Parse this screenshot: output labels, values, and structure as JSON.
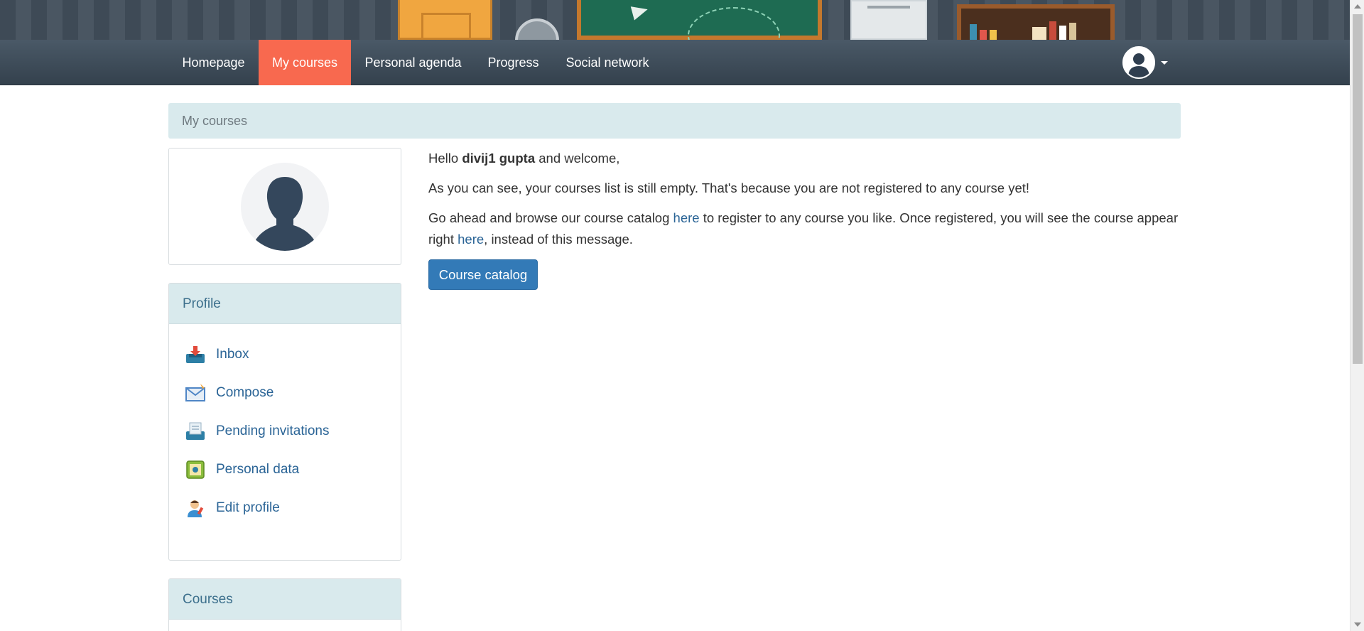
{
  "nav": {
    "items": [
      {
        "label": "Homepage",
        "active": false
      },
      {
        "label": "My courses",
        "active": true
      },
      {
        "label": "Personal agenda",
        "active": false
      },
      {
        "label": "Progress",
        "active": false
      },
      {
        "label": "Social network",
        "active": false
      }
    ],
    "user_menu_icon": "user-avatar-icon"
  },
  "breadcrumb": {
    "current": "My courses"
  },
  "sidebar": {
    "profile": {
      "title": "Profile",
      "items": [
        {
          "label": "Inbox",
          "icon": "inbox-icon"
        },
        {
          "label": "Compose",
          "icon": "compose-icon"
        },
        {
          "label": "Pending invitations",
          "icon": "pending-invitations-icon"
        },
        {
          "label": "Personal data",
          "icon": "personal-data-icon"
        },
        {
          "label": "Edit profile",
          "icon": "edit-profile-icon"
        }
      ]
    },
    "courses": {
      "title": "Courses"
    }
  },
  "main": {
    "greeting_prefix": "Hello ",
    "user_name": "divij1 gupta",
    "greeting_suffix": " and welcome,",
    "empty_message": "As you can see, your courses list is still empty. That's because you are not registered to any course yet!",
    "browse_prefix": "Go ahead and browse our course catalog ",
    "link_here_1": "here",
    "browse_middle": " to register to any course you like. Once registered, you will see the course appear right ",
    "link_here_2": "here",
    "browse_suffix": ", instead of this message.",
    "catalog_button": "Course catalog"
  },
  "colors": {
    "navbar": "#3d4a56",
    "active_tab": "#f8694f",
    "panel_heading": "#d9eaed",
    "link": "#2a6496",
    "primary_button": "#337ab7"
  }
}
